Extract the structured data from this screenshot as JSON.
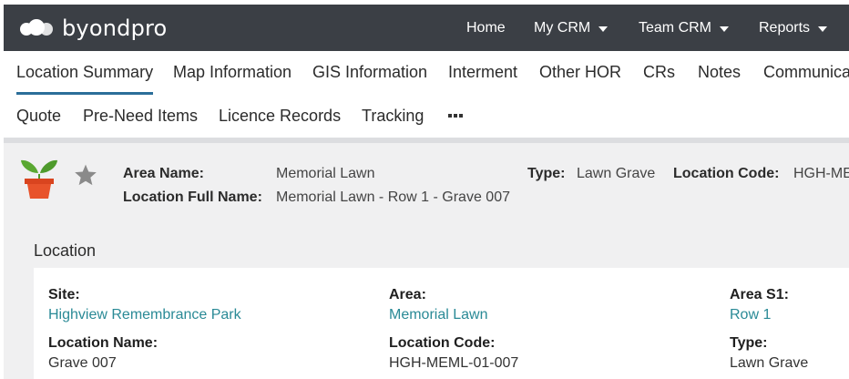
{
  "brand": {
    "name": "byondpro"
  },
  "topnav": [
    {
      "label": "Home",
      "dropdown": false
    },
    {
      "label": "My CRM",
      "dropdown": true
    },
    {
      "label": "Team CRM",
      "dropdown": true
    },
    {
      "label": "Reports",
      "dropdown": true
    }
  ],
  "tabs_row1": [
    "Location Summary",
    "Map Information",
    "GIS Information",
    "Interment",
    "Other HOR",
    "CRs",
    "Notes",
    "Communica"
  ],
  "tabs_row2": [
    "Quote",
    "Pre-Need Items",
    "Licence Records",
    "Tracking"
  ],
  "active_tab": "Location Summary",
  "header": {
    "area_name_label": "Area Name:",
    "area_name_value": "Memorial Lawn",
    "type_label": "Type:",
    "type_value": "Lawn Grave",
    "location_code_label": "Location Code:",
    "location_code_value": "HGH-ME",
    "full_name_label": "Location Full Name:",
    "full_name_value": "Memorial Lawn - Row 1 - Grave 007"
  },
  "section": {
    "title": "Location",
    "site_label": "Site:",
    "site_value": "Highview Remembrance Park",
    "area_label": "Area:",
    "area_value": "Memorial Lawn",
    "area_s1_label": "Area S1:",
    "area_s1_value": "Row 1",
    "location_name_label": "Location Name:",
    "location_name_value": "Grave 007",
    "location_code_label": "Location Code:",
    "location_code_value": "HGH-MEML-01-007",
    "type_label": "Type:",
    "type_value": "Lawn Grave"
  },
  "icons": {
    "plant": "potted-plant-icon",
    "star": "star-icon",
    "more": "more-dots-icon"
  },
  "colors": {
    "topbar": "#3b3f45",
    "active_underline": "#2b6e99",
    "link": "#2a8a96",
    "plant_pot": "#e8532b",
    "plant_leaf": "#5aa832",
    "star": "#8a8a8a"
  }
}
